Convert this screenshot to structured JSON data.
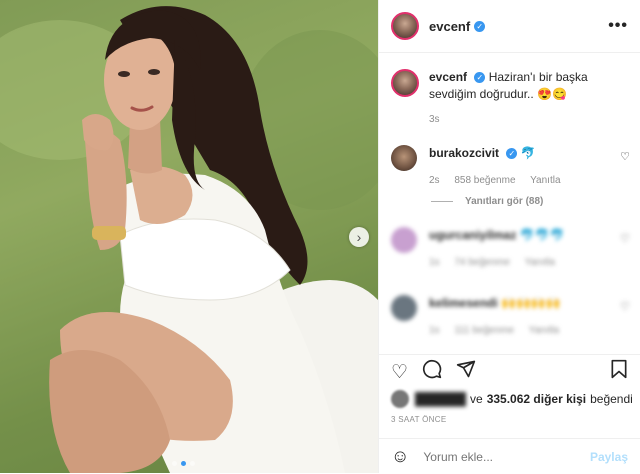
{
  "post": {
    "username": "evcenf",
    "more": "•••",
    "next_arrow": "›",
    "slide_count": 3,
    "active_slide": 2
  },
  "caption": {
    "username": "evcenf",
    "text": "Haziran'ı bir başka sevdiğim doğrudur.. 😍😋",
    "age": "3s"
  },
  "comments": [
    {
      "username": "burakozcivit",
      "text": "🐬",
      "age": "2s",
      "likes": "858 beğenme",
      "reply": "Yanıtla",
      "view_replies": "Yanıtları gör (88)"
    },
    {
      "username": "ugurcaniyilmaz",
      "text": "🐬🐬🐬",
      "age": "1s",
      "likes": "74 beğenme",
      "reply": "Yanıtla"
    },
    {
      "username": "kelimesendi",
      "text": "🙌🙌🙌🙌",
      "age": "1s",
      "likes": "111 beğenme",
      "reply": "Yanıtla"
    }
  ],
  "icons": {
    "like": "heart-icon",
    "comment": "comment-icon",
    "share": "share-icon",
    "save": "bookmark-icon",
    "emoji": "smiley-icon"
  },
  "likes": {
    "prefix": "ve",
    "count_text": "335.062 diğer kişi",
    "suffix": "beğendi"
  },
  "timestamp": "3 SAAT ÖNCE",
  "add_comment": {
    "placeholder": "Yorum ekle...",
    "post_label": "Paylaş"
  },
  "colors": {
    "accent": "#3897f0",
    "story_ring": "#e1306c",
    "muted": "#8e8e8e",
    "post_disabled": "#b2dffc"
  }
}
